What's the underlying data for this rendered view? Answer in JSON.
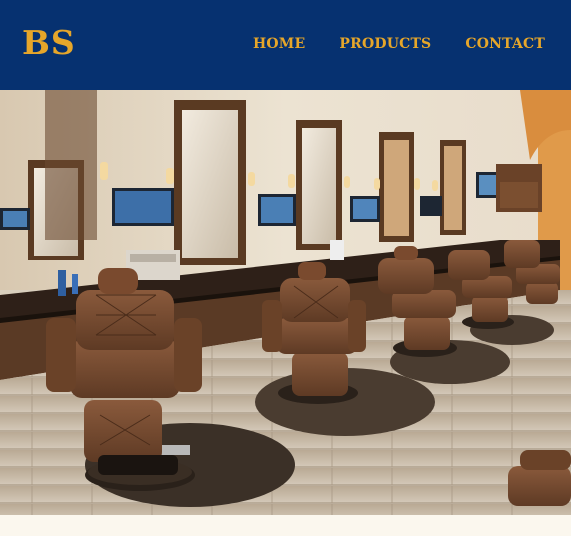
{
  "header": {
    "logo_text": "BS",
    "nav": [
      {
        "label": "HOME"
      },
      {
        "label": "PRODUCTS"
      },
      {
        "label": "CONTACT"
      }
    ]
  },
  "hero": {
    "image": "barbershop-interior-photo"
  },
  "colors": {
    "header_bg": "#063170",
    "accent": "#e6a62a",
    "page_bg": "#fbf7ee"
  }
}
